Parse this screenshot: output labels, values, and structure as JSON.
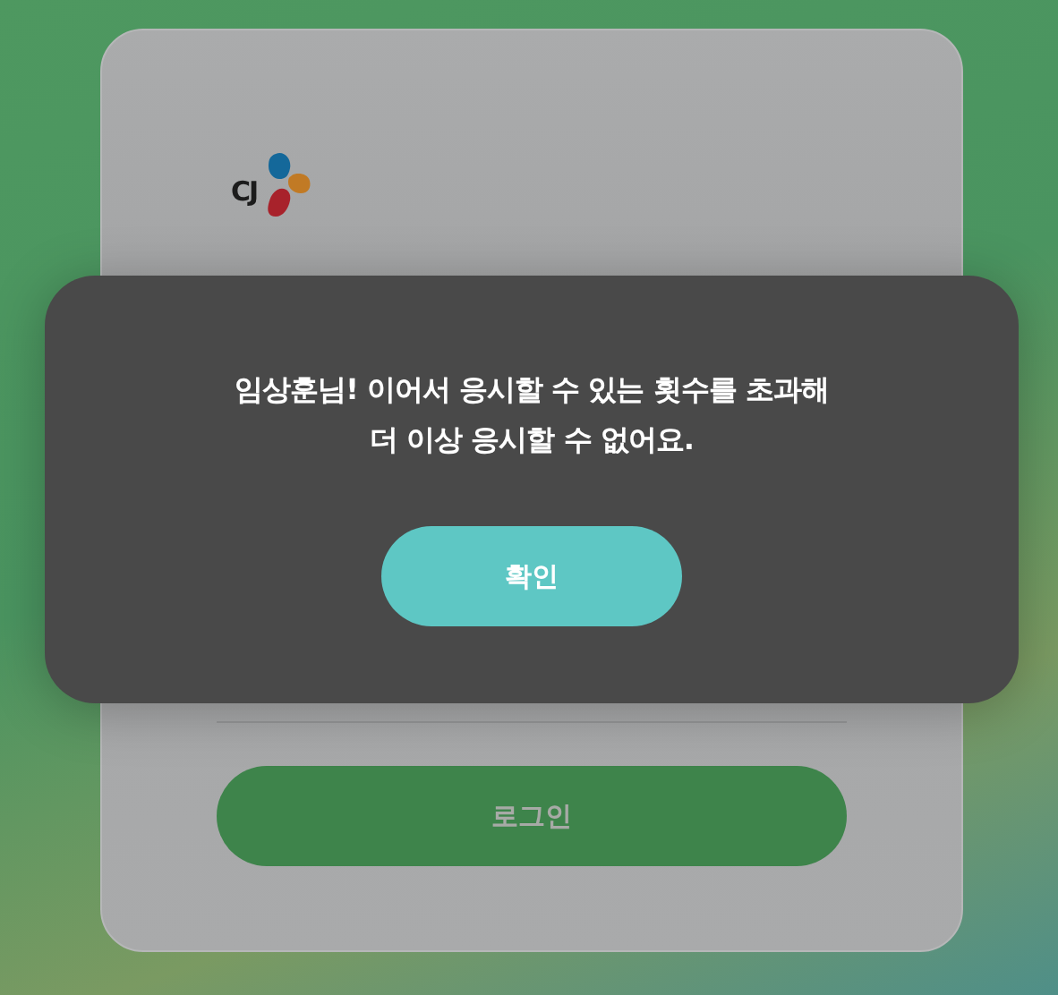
{
  "login_card": {
    "logo": {
      "text": "CJ"
    },
    "login_button": {
      "label": "로그인",
      "disabled": true
    }
  },
  "dialog": {
    "message": "임상훈님! 이어서 응시할 수 있는 횟수를 초과해\n더 이상 응시할 수 없어요.",
    "confirm_button": {
      "label": "확인"
    }
  }
}
